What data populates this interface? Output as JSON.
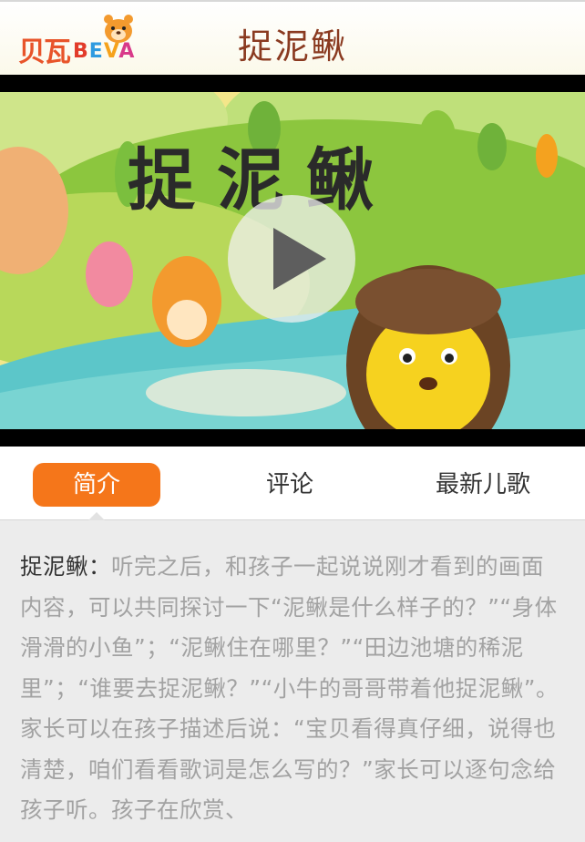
{
  "header": {
    "logo_text_cn": "贝瓦",
    "logo_text_en_1": "B",
    "logo_text_en_2": "E",
    "logo_text_en_3": "V",
    "logo_text_en_4": "A",
    "title": "捉泥鳅"
  },
  "video": {
    "overlay_title": "捉泥鳅"
  },
  "tabs": [
    {
      "label": "简介",
      "active": true
    },
    {
      "label": "评论",
      "active": false
    },
    {
      "label": "最新儿歌",
      "active": false
    }
  ],
  "intro": {
    "lead": "捉泥鳅：",
    "text": "听完之后，和孩子一起说说刚才看到的画面内容，可以共同探讨一下“泥鳅是什么样子的？”“身体滑滑的小鱼”；“泥鳅住在哪里？”“田边池塘的稀泥里”；“谁要去捉泥鳅？”“小牛的哥哥带着他捉泥鳅”。家长可以在孩子描述后说：“宝贝看得真仔细，说得也清楚，咱们看看歌词是怎么写的？”家长可以逐句念给孩子听。孩子在欣赏、"
  },
  "colors": {
    "accent": "#f5761a",
    "title": "#8a3a20"
  }
}
